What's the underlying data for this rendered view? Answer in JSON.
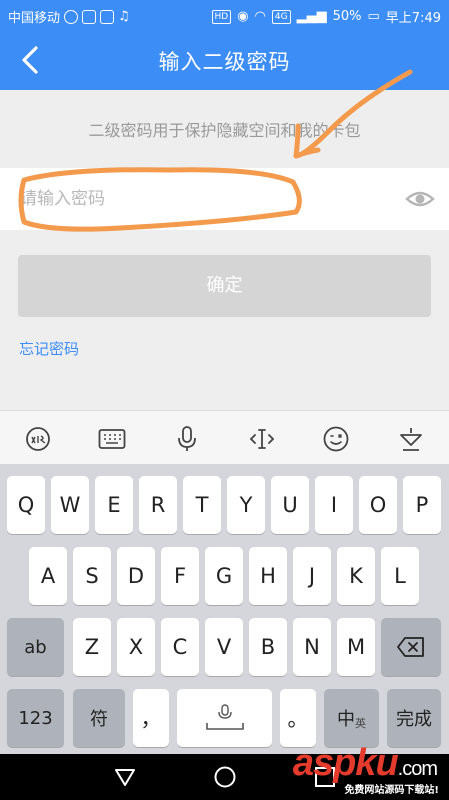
{
  "status_bar": {
    "carrier": "中国移动",
    "hd_badge": "HD",
    "network_badge": "4G",
    "battery": "50%",
    "time": "早上7:49"
  },
  "header": {
    "title": "输入二级密码"
  },
  "content": {
    "hint": "二级密码用于保护隐藏空间和我的卡包",
    "password_placeholder": "请输入密码",
    "password_value": "",
    "confirm_label": "确定",
    "forgot_label": "忘记密码"
  },
  "keyboard": {
    "row1": [
      "Q",
      "W",
      "E",
      "R",
      "T",
      "Y",
      "U",
      "I",
      "O",
      "P"
    ],
    "row2": [
      "A",
      "S",
      "D",
      "F",
      "G",
      "H",
      "J",
      "K",
      "L"
    ],
    "row3": [
      "Z",
      "X",
      "C",
      "V",
      "B",
      "N",
      "M"
    ],
    "shift_label": "ab",
    "num_label": "123",
    "symbol_label": "符",
    "comma_label": "，",
    "period_label": "。",
    "lang_label": "中",
    "lang_sub": "英",
    "done_label": "完成"
  },
  "watermark": {
    "logo": "aspku",
    "domain": ".com",
    "tagline": "免费网站源码下载站!"
  },
  "colors": {
    "accent": "#3c8df6",
    "annotation": "#f39a4d",
    "watermark": "#e53b2c"
  }
}
